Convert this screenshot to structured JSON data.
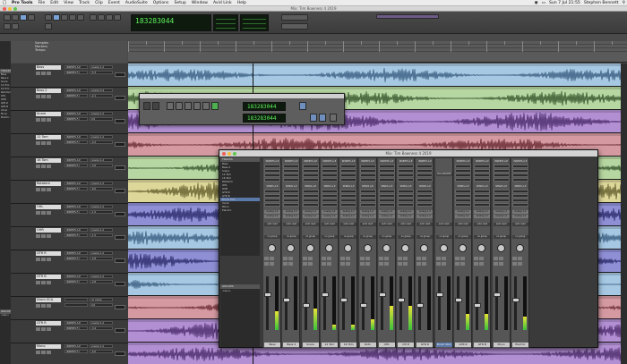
{
  "menubar": {
    "apple_icon": "apple-icon",
    "app_name": "Pro Tools",
    "items": [
      "File",
      "Edit",
      "View",
      "Track",
      "Clip",
      "Event",
      "AudioSuite",
      "Options",
      "Setup",
      "Window",
      "Avid Link",
      "Help"
    ],
    "clock": "Sun 7 Jul  21:55",
    "user": "Stephen Bennett"
  },
  "edit_window": {
    "title": "Mix: Tim Bowness 4 2019",
    "main_counter": "183283044",
    "ruler_labels": [
      "Samples",
      "Markers",
      "Tempo"
    ],
    "left_panel": {
      "tracks_header": "TRACKS",
      "tracks": [
        "Bass",
        "Bass 2",
        "Snare",
        "12 Tom",
        "16 Tom",
        "Rototom",
        "OHL",
        "OHR",
        "GTR R",
        "GTR B",
        "Vocal",
        "Mono",
        "Electric"
      ],
      "groups_header": "GROUPS",
      "groups": [
        "<ALL>"
      ]
    },
    "tracks": [
      {
        "name": "Bass",
        "inserts": [
          "INSERTS A-E",
          "INSERTS F-J"
        ],
        "io": "Analog 1-2",
        "vol": "-5.3"
      },
      {
        "name": "Bass 2",
        "inserts": [
          "INSERTS A-E",
          "INSERTS F-J"
        ],
        "io": "Analog 3-4",
        "vol": "-2.1"
      },
      {
        "name": "Snare",
        "inserts": [
          "INSERTS A-E",
          "INSERTS F-J"
        ],
        "io": "Analog 1-2",
        "vol": "0.0"
      },
      {
        "name": "12 Tom",
        "inserts": [
          "INSERTS A-E",
          "INSERTS F-J"
        ],
        "io": "Analog 1-2",
        "vol": "-4.2"
      },
      {
        "name": "16 Tom",
        "inserts": [
          "INSERTS A-E",
          "INSERTS F-J"
        ],
        "io": "Analog 1-2",
        "vol": "-3.0"
      },
      {
        "name": "Rototom",
        "inserts": [
          "INSERTS A-E",
          "INSERTS F-J"
        ],
        "io": "Analog 1-2",
        "vol": "-6.0"
      },
      {
        "name": "OHL",
        "inserts": [
          "INSERTS A-E",
          "INSERTS F-J"
        ],
        "io": "Analog 1-2",
        "vol": "-1.5"
      },
      {
        "name": "OHR",
        "inserts": [
          "INSERTS A-E",
          "INSERTS F-J"
        ],
        "io": "Analog 1-2",
        "vol": "-1.5"
      },
      {
        "name": "GTR R",
        "inserts": [
          "INSERTS A-E",
          "INSERTS F-J"
        ],
        "io": "Analog 1-2",
        "vol": "-2.8"
      },
      {
        "name": "GTR B",
        "inserts": [
          "INSERTS A-E",
          "INSERTS F-J"
        ],
        "io": "Analog 1-2",
        "vol": "-2.8"
      },
      {
        "name": "Drum VCA",
        "inserts": [
          "",
          ""
        ],
        "io": "no group",
        "vol": "0.0"
      },
      {
        "name": "GTR R",
        "inserts": [
          "INSERTS A-E",
          "INSERTS F-J"
        ],
        "io": "Analog 1-2",
        "vol": "-3.4"
      },
      {
        "name": "Mono",
        "inserts": [
          "INSERTS A-E",
          "INSERTS F-J"
        ],
        "io": "Analog 1-2",
        "vol": "-4.0"
      }
    ]
  },
  "transport": {
    "counter_main": "183283044",
    "counter_sub": "183283044"
  },
  "mix_window": {
    "title": "Mix: Tim Bowness 4 2019",
    "tracks_header": "TRACKS",
    "tracks": [
      "Bass",
      "Bass 2",
      "Snare",
      "12 Tom",
      "16 Tom",
      "Rototom",
      "OHL",
      "OHR",
      "GTR R",
      "GTR B",
      "Drum VCA",
      "Vocal",
      "Mono",
      "Electric"
    ],
    "selected_track": "Drum VCA",
    "groups_header": "GROUPS",
    "groups": [
      "<ALL>"
    ],
    "vca_label": "VCA MASTER",
    "insert_header": "INSERTS A-E",
    "send_header": "SENDS A-E",
    "strips": [
      {
        "name": "Bass",
        "io": "Analog 1-2",
        "mode": "auto read",
        "group": "no group",
        "meter": 0.35
      },
      {
        "name": "Bass 2",
        "io": "Analog 3-4",
        "mode": "auto read",
        "group": "no group",
        "meter": 0.0
      },
      {
        "name": "Snare",
        "io": "Analog 1-2",
        "mode": "auto read",
        "group": "no group",
        "meter": 0.4
      },
      {
        "name": "12 Tom",
        "io": "Analog 1-2",
        "mode": "auto read",
        "group": "no group",
        "meter": 0.1
      },
      {
        "name": "16 Tom",
        "io": "Analog 1-2",
        "mode": "auto read",
        "group": "no group",
        "meter": 0.1
      },
      {
        "name": "Roto",
        "io": "Analog 1-2",
        "mode": "auto read",
        "group": "no group",
        "meter": 0.2
      },
      {
        "name": "OHL",
        "io": "Analog 1-2",
        "mode": "auto read",
        "group": "no group",
        "meter": 0.45
      },
      {
        "name": "OH R",
        "io": "Analog 1-2",
        "mode": "auto read",
        "group": "no group",
        "meter": 0.45
      },
      {
        "name": "GTR R",
        "io": "Analog 1-2",
        "mode": "auto read",
        "group": "no group",
        "meter": 0.0
      },
      {
        "name": "Drum VCA",
        "io": "",
        "mode": "auto read",
        "group": "no group",
        "meter": 0.0
      },
      {
        "name": "GTR R",
        "io": "Analog 1-2",
        "mode": "auto read",
        "group": "no group",
        "meter": 0.3
      },
      {
        "name": "GTR B",
        "io": "Analog 1-2",
        "mode": "auto read",
        "group": "no group",
        "meter": 0.3
      },
      {
        "name": "Mono",
        "io": "Analog 1-2",
        "mode": "auto read",
        "group": "no group",
        "meter": 0.0
      },
      {
        "name": "Electric",
        "io": "Analog 1-2",
        "mode": "auto read",
        "group": "no group",
        "meter": 0.25
      }
    ]
  },
  "colors": {
    "lane_blue": "#a6c8e3",
    "wave_blue": "#2b4f73",
    "lane_green": "#b7d7a2",
    "wave_green": "#23421b",
    "lane_purple": "#b28fd3",
    "wave_purple": "#3d1d5c",
    "lane_red": "#d59aa1",
    "wave_red": "#5b1a23",
    "lane_yellow": "#ddd79a",
    "wave_yellow": "#514c1c",
    "lane_violet": "#8f8fd6",
    "wave_violet": "#1c1c5b",
    "counter_text": "#5ef05e"
  }
}
